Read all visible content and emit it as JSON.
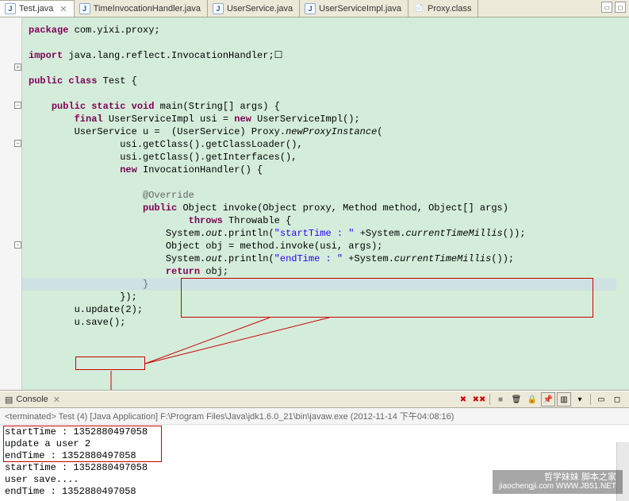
{
  "tabs": [
    {
      "label": "Test.java",
      "active": true,
      "icon": "J"
    },
    {
      "label": "TimeInvocationHandler.java",
      "active": false,
      "icon": "J"
    },
    {
      "label": "UserService.java",
      "active": false,
      "icon": "J"
    },
    {
      "label": "UserServiceImpl.java",
      "active": false,
      "icon": "J"
    },
    {
      "label": "Proxy.class",
      "active": false,
      "icon": "C"
    }
  ],
  "code": {
    "package_kw": "package",
    "package_name": " com.yixi.proxy;",
    "import_kw": "import",
    "import_name": " java.lang.reflect.InvocationHandler;",
    "import_suffix": "☐",
    "l_public": "public",
    "l_class": "class",
    "class_name": " Test {",
    "l_static": "static",
    "l_void": "void",
    "main_sig": " main(String[] args) {",
    "l_final": "final",
    "usi_decl": " UserServiceImpl usi = ",
    "l_new": "new",
    "usi_ctor": " UserServiceImpl();",
    "u_decl": "UserService u =  (UserService) Proxy.",
    "newproxy": "newProxyInstance",
    "newproxy_open": "(",
    "line_loader": "usi.getClass().getClassLoader(),",
    "line_interfaces": "usi.getClass().getInterfaces(),",
    "ih_ctor": " InvocationHandler() {",
    "override": "@Override",
    "invoke_sig1": " Object invoke(Object proxy, Method method, Object[] args)",
    "l_throws": "throws",
    "throws_cl": " Throwable {",
    "sys": "System.",
    "out": "out",
    "println": ".println(",
    "str_start": "\"startTime : \"",
    "plus_sys": " +System.",
    "ctm": "currentTimeMillis",
    "close_paren": "());",
    "obj_line": "Object obj = method.invoke(usi, args);",
    "str_end": "\"endTime : \"",
    "l_return": "return",
    "return_obj": " obj;",
    "close1": "}",
    "close2": "});",
    "u_update": "u.update(2);",
    "u_save": "u.save();"
  },
  "console": {
    "title": "Console",
    "info": "<terminated> Test (4) [Java Application] F:\\Program Files\\Java\\jdk1.6.0_21\\bin\\javaw.exe (2012-11-14 下午04:08:16)",
    "lines": [
      "startTime : 1352880497058",
      "update a user 2",
      "endTime : 1352880497058",
      "startTime : 1352880497058",
      "user save....",
      "endTime : 1352880497058"
    ]
  },
  "watermark": {
    "cn": "哲学妹妹 脚本之家",
    "url": "jiaochengji.com   WWW.JB51.NET"
  }
}
